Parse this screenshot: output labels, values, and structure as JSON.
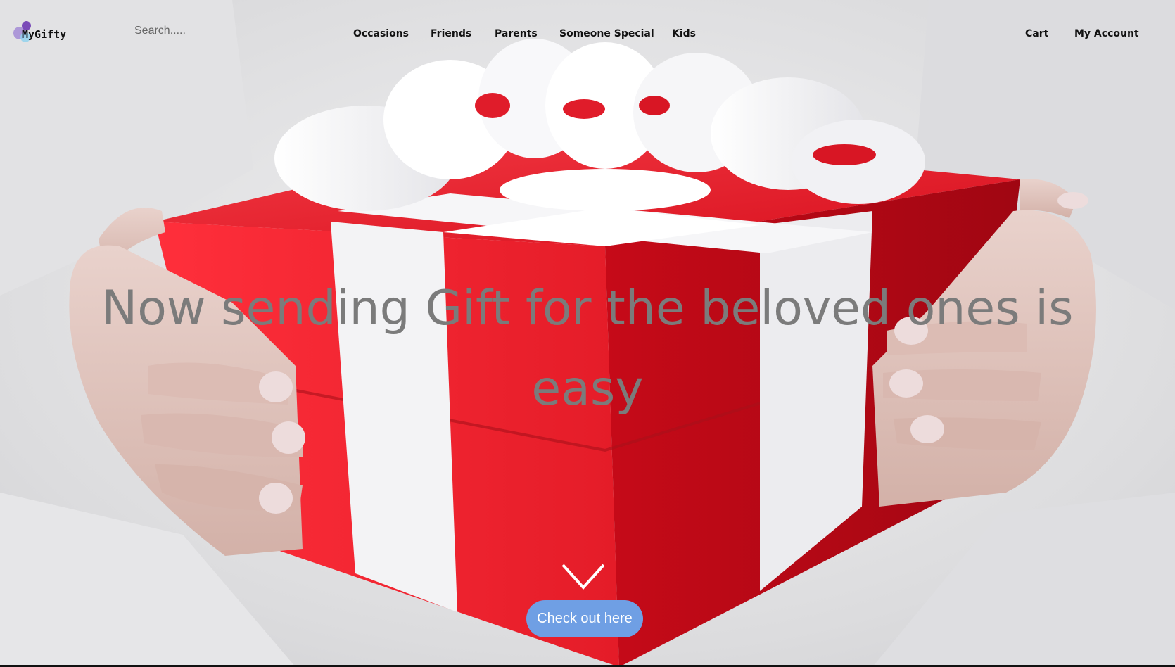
{
  "brand": {
    "name": "MyGifty",
    "logo_colors": [
      "#9b7fd4",
      "#7a4bb8",
      "#8fd2ee"
    ]
  },
  "search": {
    "placeholder": "Search.....",
    "value": ""
  },
  "nav": {
    "items": [
      {
        "label": "Occasions"
      },
      {
        "label": "Friends"
      },
      {
        "label": "Parents"
      },
      {
        "label": "Someone Special"
      },
      {
        "label": "Kids"
      }
    ],
    "right_items": [
      {
        "label": "Cart"
      },
      {
        "label": "My Account"
      }
    ]
  },
  "hero": {
    "title": "Now sending Gift for the beloved ones is easy",
    "scroll_icon": "chevron-down-icon",
    "cta_label": "Check out here",
    "cta_color": "#6f9fe4",
    "gift_box_color": "#e8202e",
    "ribbon_color": "#f4f4f6"
  }
}
